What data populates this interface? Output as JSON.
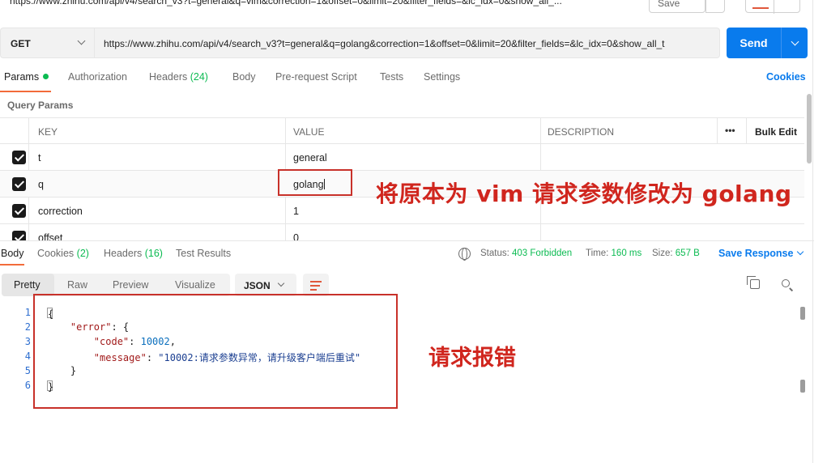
{
  "top": {
    "url_cropped": "https://www.zhihu.com/api/v4/search_v3?t=general&q=vim&correction=1&offset=0&limit=20&filter_fields=&lc_idx=0&show_all_...",
    "save_label": "Save"
  },
  "request": {
    "method": "GET",
    "url": "https://www.zhihu.com/api/v4/search_v3?t=general&q=golang&correction=1&offset=0&limit=20&filter_fields=&lc_idx=0&show_all_t",
    "send_label": "Send"
  },
  "request_tabs": [
    {
      "label": "Params",
      "count": ""
    },
    {
      "label": "Authorization",
      "count": ""
    },
    {
      "label": "Headers",
      "count": "(24)"
    },
    {
      "label": "Body",
      "count": ""
    },
    {
      "label": "Pre-request Script",
      "count": ""
    },
    {
      "label": "Tests",
      "count": ""
    },
    {
      "label": "Settings",
      "count": ""
    }
  ],
  "cookies_label": "Cookies",
  "query_params": {
    "title": "Query Params",
    "headers": {
      "key": "KEY",
      "value": "VALUE",
      "description": "DESCRIPTION",
      "more": "•••",
      "bulk_edit": "Bulk Edit"
    },
    "rows": [
      {
        "key": "t",
        "value": "general",
        "checked": true
      },
      {
        "key": "q",
        "value": "golang",
        "checked": true
      },
      {
        "key": "correction",
        "value": "1",
        "checked": true
      },
      {
        "key": "offset",
        "value": "0",
        "checked": true
      }
    ]
  },
  "annotations": {
    "param_note": "将原本为 vim 请求参数修改为 golang",
    "error_note": "请求报错",
    "color": "#d0261e"
  },
  "response_tabs": [
    {
      "label": "Body",
      "count": ""
    },
    {
      "label": "Cookies",
      "count": "(2)"
    },
    {
      "label": "Headers",
      "count": "(16)"
    },
    {
      "label": "Test Results",
      "count": ""
    }
  ],
  "response_status": {
    "status_label": "Status:",
    "status_value": "403 Forbidden",
    "time_label": "Time:",
    "time_value": "160 ms",
    "size_label": "Size:",
    "size_value": "657 B",
    "save_response": "Save Response"
  },
  "view_tabs": [
    "Pretty",
    "Raw",
    "Preview",
    "Visualize"
  ],
  "format": "JSON",
  "response_body": {
    "line_numbers": [
      "1",
      "2",
      "3",
      "4",
      "5",
      "6"
    ],
    "error_key": "\"error\"",
    "code_key": "\"code\"",
    "code_value": "10002",
    "message_key": "\"message\"",
    "message_value": "\"10002:请求参数异常，请升级客户端后重试\""
  },
  "icons": {
    "globe": "globe-icon",
    "copy": "copy-icon",
    "search": "search-icon",
    "wrap": "wrap-lines-icon"
  }
}
